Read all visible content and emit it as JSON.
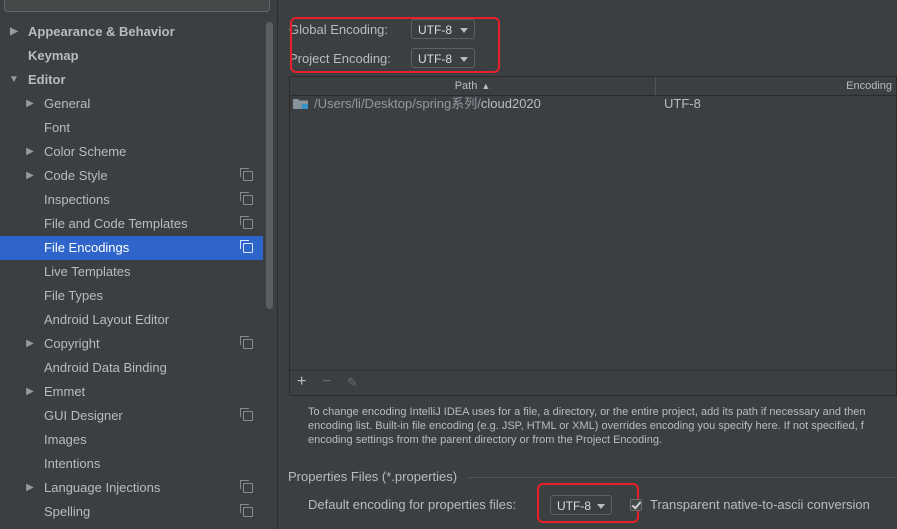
{
  "sidebar": {
    "items": [
      {
        "label": "Appearance & Behavior",
        "bold": true,
        "arrow": "collapsed",
        "level": 0
      },
      {
        "label": "Keymap",
        "bold": true,
        "arrow": "",
        "level": 0
      },
      {
        "label": "Editor",
        "bold": true,
        "arrow": "expanded",
        "level": 0
      },
      {
        "label": "General",
        "arrow": "collapsed",
        "level": 1
      },
      {
        "label": "Font",
        "arrow": "",
        "level": 1
      },
      {
        "label": "Color Scheme",
        "arrow": "collapsed",
        "level": 1
      },
      {
        "label": "Code Style",
        "arrow": "collapsed",
        "level": 1,
        "copy": true
      },
      {
        "label": "Inspections",
        "arrow": "",
        "level": 1,
        "copy": true
      },
      {
        "label": "File and Code Templates",
        "arrow": "",
        "level": 1,
        "copy": true
      },
      {
        "label": "File Encodings",
        "arrow": "",
        "level": 1,
        "copy": true,
        "selected": true
      },
      {
        "label": "Live Templates",
        "arrow": "",
        "level": 1
      },
      {
        "label": "File Types",
        "arrow": "",
        "level": 1
      },
      {
        "label": "Android Layout Editor",
        "arrow": "",
        "level": 1
      },
      {
        "label": "Copyright",
        "arrow": "collapsed",
        "level": 1,
        "copy": true
      },
      {
        "label": "Android Data Binding",
        "arrow": "",
        "level": 1
      },
      {
        "label": "Emmet",
        "arrow": "collapsed",
        "level": 1
      },
      {
        "label": "GUI Designer",
        "arrow": "",
        "level": 1,
        "copy": true
      },
      {
        "label": "Images",
        "arrow": "",
        "level": 1
      },
      {
        "label": "Intentions",
        "arrow": "",
        "level": 1
      },
      {
        "label": "Language Injections",
        "arrow": "collapsed",
        "level": 1,
        "copy": true
      },
      {
        "label": "Spelling",
        "arrow": "",
        "level": 1,
        "copy": true
      }
    ]
  },
  "encodings": {
    "global_label": "Global Encoding:",
    "global_value": "UTF-8",
    "project_label": "Project Encoding:",
    "project_value": "UTF-8"
  },
  "table": {
    "col_path": "Path",
    "col_encoding": "Encoding",
    "rows": [
      {
        "path_prefix": "/Users/li/Desktop/spring系列/",
        "path_name": "cloud2020",
        "encoding": "UTF-8"
      }
    ],
    "add_label": "+",
    "remove_label": "−",
    "edit_label": "✎"
  },
  "hint_lines": [
    "To change encoding IntelliJ IDEA uses for a file, a directory, or the entire project, add its path if necessary and then",
    "encoding list. Built-in file encoding (e.g. JSP, HTML or XML) overrides encoding you specify here. If not specified, f",
    "encoding settings from the parent directory or from the Project Encoding."
  ],
  "properties": {
    "title": "Properties Files (*.properties)",
    "default_label": "Default encoding for properties files:",
    "default_value": "UTF-8",
    "native_label": "Transparent native-to-ascii conversion",
    "native_checked": true
  },
  "colors": {
    "background": "#3c3f41",
    "selection": "#2f65ca",
    "highlight_box": "#e5202a"
  }
}
